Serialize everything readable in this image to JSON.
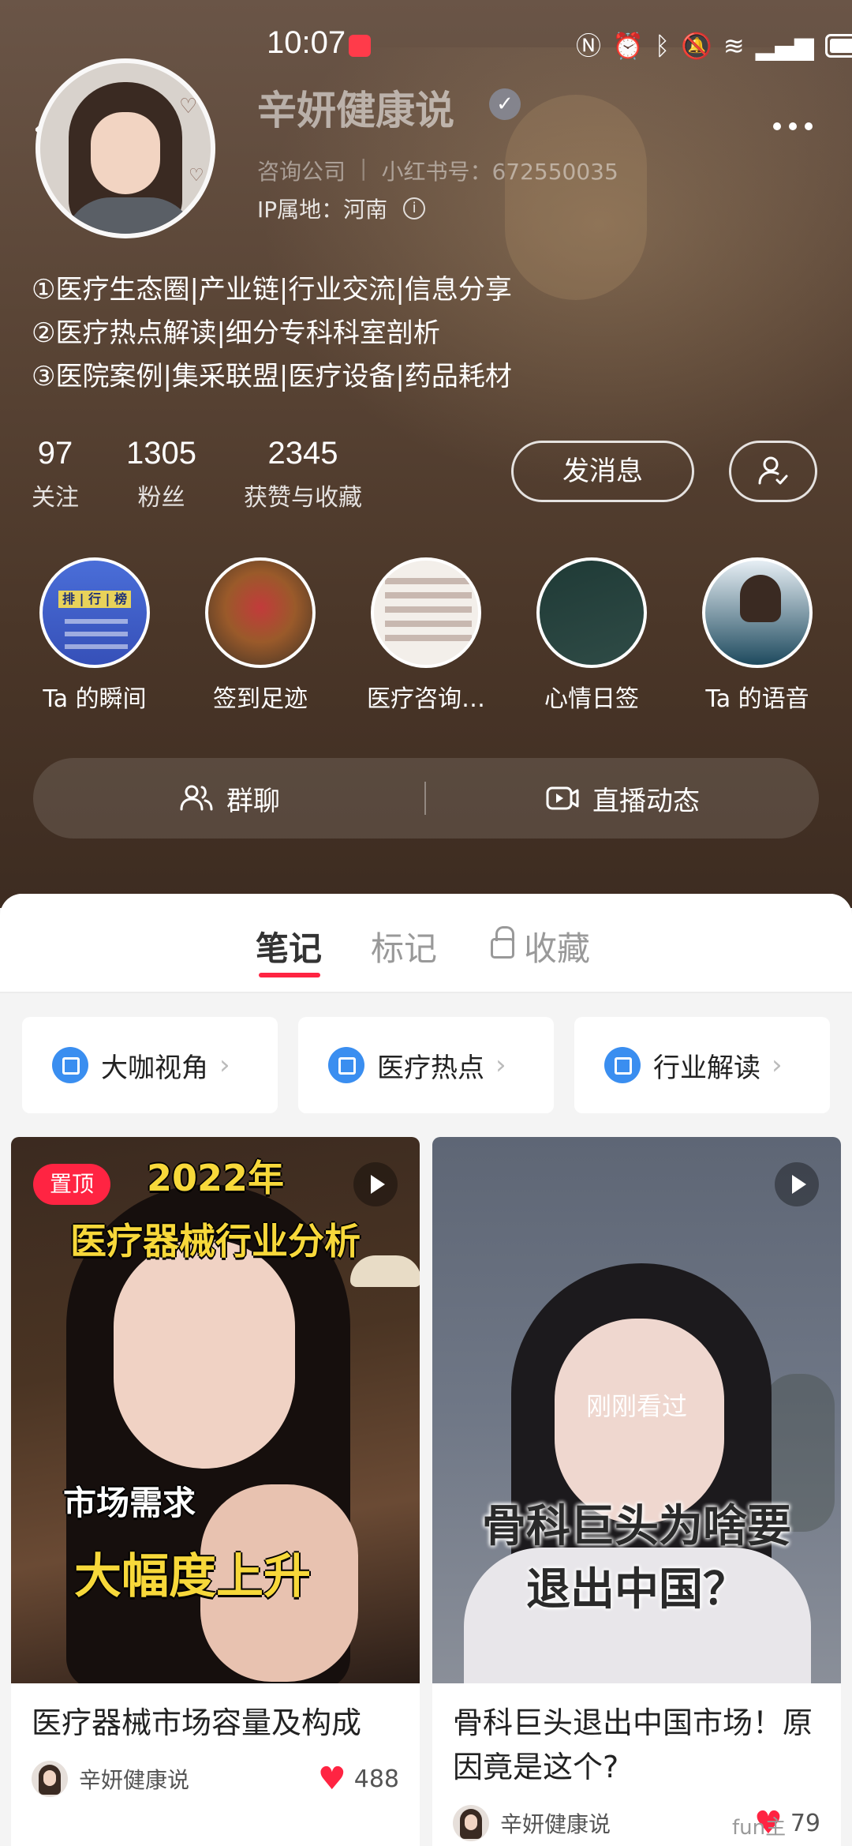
{
  "status_bar": {
    "time": "10:07"
  },
  "profile": {
    "nickname": "辛妍健康说",
    "category": "咨询公司",
    "redbook_id": "小红书号：672550035",
    "ip_location": "IP属地：河南",
    "bio": [
      "①医疗生态圈|产业链|行业交流|信息分享",
      "②医疗热点解读|细分专科科室剖析",
      "③医院案例|集采联盟|医疗设备|药品耗材"
    ],
    "stats": [
      {
        "value": "97",
        "label": "关注"
      },
      {
        "value": "1305",
        "label": "粉丝"
      },
      {
        "value": "2345",
        "label": "获赞与收藏"
      }
    ],
    "message_button": "发消息",
    "highlights": [
      {
        "label": "Ta 的瞬间",
        "cover_text": "排 | 行 | 榜"
      },
      {
        "label": "签到足迹"
      },
      {
        "label": "医疗咨询…"
      },
      {
        "label": "心情日签"
      },
      {
        "label": "Ta 的语音"
      }
    ],
    "group_chat": "群聊",
    "live_feed": "直播动态"
  },
  "tabs": {
    "notes": "笔记",
    "marks": "标记",
    "favorites": "收藏"
  },
  "collections": [
    {
      "label": "大咖视角"
    },
    {
      "label": "医疗热点"
    },
    {
      "label": "行业解读"
    }
  ],
  "feed": [
    {
      "pinned_label": "置顶",
      "overlay_lines": [
        "2022年",
        "医疗器械行业分析",
        "市场需求",
        "大幅度上升"
      ],
      "title": "医疗器械市场容量及构成",
      "author": "辛妍健康说",
      "likes": "488"
    },
    {
      "seen_label": "刚刚看过",
      "overlay_lines": [
        "骨科巨头为啥要",
        "退出中国？"
      ],
      "title": "骨科巨头退出中国市场！原因竟是这个?",
      "author": "辛妍健康说",
      "likes": "79"
    }
  ],
  "watermark": "fun主",
  "icons": {
    "back": "chevron-left-icon",
    "more": "more-dots-icon",
    "verified": "verified-badge-icon",
    "follow": "person-check-icon",
    "group": "people-icon",
    "live": "camera-icon",
    "lock": "lock-icon",
    "collection": "album-icon",
    "play": "play-icon",
    "like": "heart-icon"
  },
  "colors": {
    "accent": "#ff2442",
    "collection_icon": "#3a8ef0"
  }
}
